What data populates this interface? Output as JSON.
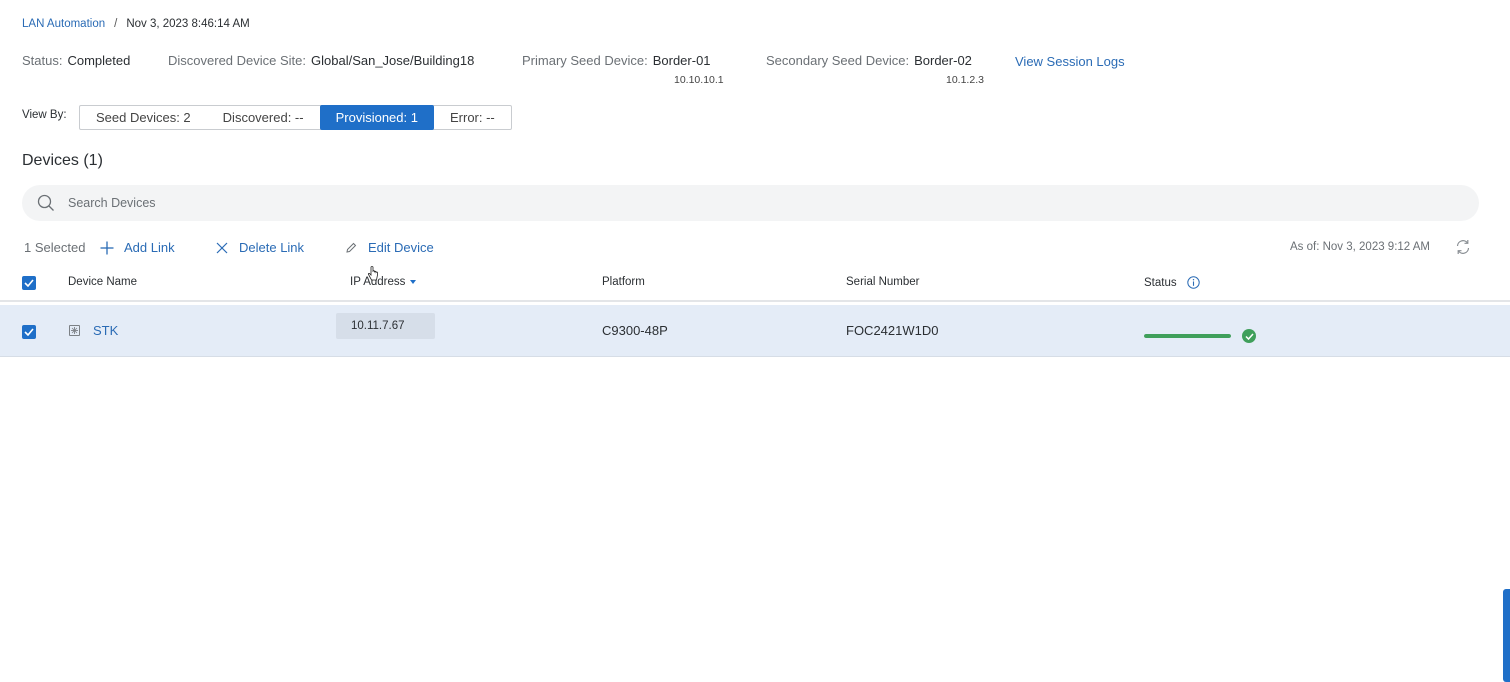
{
  "breadcrumb": {
    "parent": "LAN Automation",
    "separator": "/",
    "current": "Nov 3, 2023 8:46:14 AM"
  },
  "summary": {
    "status_label": "Status:",
    "status_value": "Completed",
    "site_label": "Discovered Device Site:",
    "site_value": "Global/San_Jose/Building18",
    "primary_label": "Primary Seed Device:",
    "primary_value": "Border-01",
    "primary_ip": "10.10.10.1",
    "secondary_label": "Secondary Seed Device:",
    "secondary_value": "Border-02",
    "secondary_ip": "10.1.2.3",
    "session_logs_link": "View Session Logs"
  },
  "view_by": {
    "label": "View By:",
    "segments": [
      {
        "label": "Seed Devices: 2",
        "active": false
      },
      {
        "label": "Discovered: --",
        "active": false
      },
      {
        "label": "Provisioned: 1",
        "active": true
      },
      {
        "label": "Error: --",
        "active": false
      }
    ]
  },
  "devices_title": "Devices (1)",
  "search": {
    "placeholder": "Search Devices",
    "value": ""
  },
  "actions": {
    "selected_count": "1 Selected",
    "add_link": "Add Link",
    "delete_link": "Delete Link",
    "edit_device": "Edit Device",
    "as_of": "As of: Nov 3, 2023 9:12 AM"
  },
  "table": {
    "columns": [
      "Device Name",
      "IP Address",
      "Platform",
      "Serial Number",
      "Status"
    ],
    "sort_column": "IP Address",
    "rows": [
      {
        "selected": true,
        "device_name": "STK",
        "ip": "10.11.7.67",
        "platform": "C9300-48P",
        "serial": "FOC2421W1D0",
        "status_progress": 1.0,
        "status_icon": "check-circle-icon"
      }
    ]
  },
  "colors": {
    "accent": "#1f6fc8",
    "link": "#2a6bb5",
    "success": "#3f9f5b",
    "row_selected": "#e4ecf7"
  },
  "icons": [
    "search-icon",
    "plus-icon",
    "close-icon",
    "pencil-icon",
    "refresh-icon",
    "info-icon",
    "checkbox-checked-icon",
    "device-icon",
    "check-circle-icon"
  ]
}
